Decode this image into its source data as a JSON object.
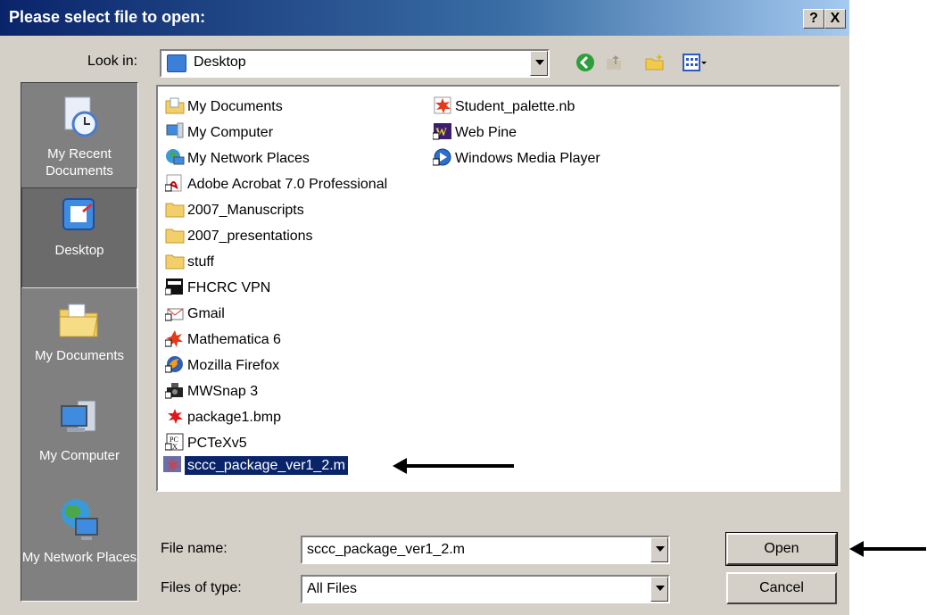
{
  "title": "Please select file to open:",
  "title_buttons": {
    "help": "?",
    "close": "X"
  },
  "look_in": {
    "label": "Look in:",
    "value": "Desktop"
  },
  "toolbar_icons": [
    "back-icon",
    "up-folder-icon",
    "new-folder-icon",
    "view-menu-icon"
  ],
  "places": [
    {
      "label": "My Recent Documents",
      "icon": "recent-documents-icon"
    },
    {
      "label": "Desktop",
      "icon": "desktop-icon",
      "selected": true
    },
    {
      "label": "My Documents",
      "icon": "my-documents-icon"
    },
    {
      "label": "My Computer",
      "icon": "my-computer-icon"
    },
    {
      "label": "My Network Places",
      "icon": "network-places-icon"
    }
  ],
  "files": [
    {
      "name": "My Documents",
      "icon": "folder-docs-icon"
    },
    {
      "name": "My Computer",
      "icon": "computer-icon"
    },
    {
      "name": "My Network Places",
      "icon": "network-icon"
    },
    {
      "name": "Adobe Acrobat 7.0 Professional",
      "icon": "acrobat-shortcut-icon"
    },
    {
      "name": "2007_Manuscripts",
      "icon": "folder-icon"
    },
    {
      "name": "2007_presentations",
      "icon": "folder-icon"
    },
    {
      "name": "stuff",
      "icon": "folder-icon"
    },
    {
      "name": "FHCRC VPN",
      "icon": "vpn-shortcut-icon"
    },
    {
      "name": "Gmail",
      "icon": "gmail-shortcut-icon"
    },
    {
      "name": "Mathematica 6",
      "icon": "mathematica-shortcut-icon"
    },
    {
      "name": "Mozilla Firefox",
      "icon": "firefox-shortcut-icon"
    },
    {
      "name": "MWSnap 3",
      "icon": "mwsnap-shortcut-icon"
    },
    {
      "name": "package1.bmp",
      "icon": "bmp-file-icon"
    },
    {
      "name": "PCTeXv5",
      "icon": "pctex-shortcut-icon"
    },
    {
      "name": "sccc_package_ver1_2.m",
      "icon": "mathematica-file-icon",
      "selected": true
    },
    {
      "name": "Student_palette.nb",
      "icon": "notebook-file-icon"
    },
    {
      "name": "Web Pine",
      "icon": "webpine-shortcut-icon"
    },
    {
      "name": "Windows Media Player",
      "icon": "media-player-shortcut-icon"
    }
  ],
  "file_name": {
    "label": "File name:",
    "value": "sccc_package_ver1_2.m"
  },
  "file_type": {
    "label": "Files of type:",
    "value": "All Files"
  },
  "buttons": {
    "open": "Open",
    "cancel": "Cancel"
  },
  "colors": {
    "title_bar": "#0a246a",
    "dialog_bg": "#d4d0c8",
    "selection": "#0a246a",
    "places_bg": "#808080"
  }
}
